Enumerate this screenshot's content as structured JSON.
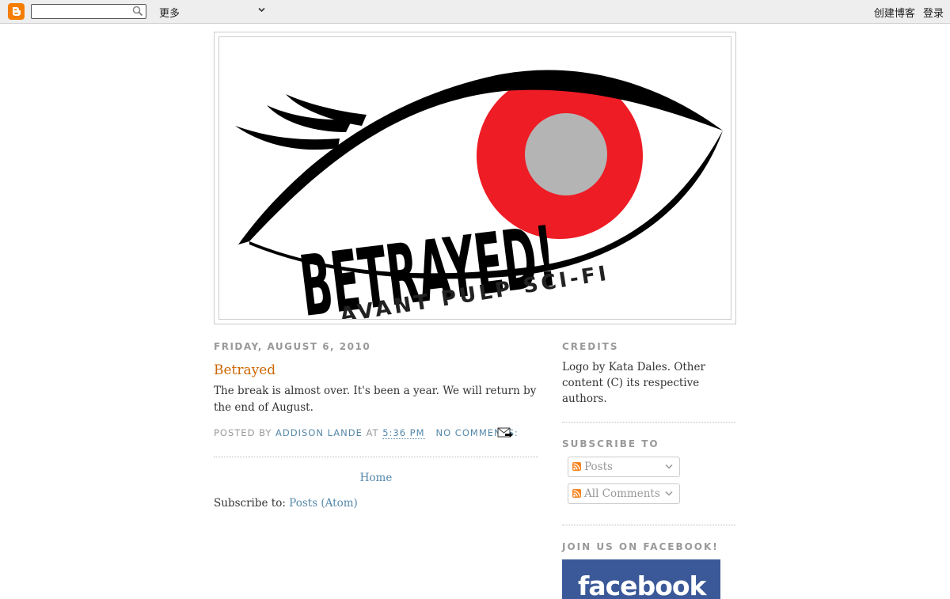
{
  "navbar": {
    "more_label": "更多",
    "create_blog_label": "创建博客",
    "login_label": "登录",
    "search_value": ""
  },
  "header": {
    "logo_title": "BETRAYED!",
    "logo_tagline": "AVANT PULP SCI-FI",
    "colors": {
      "iris": "#ee1c25",
      "pupil": "#b4b4b4",
      "ink": "#000000"
    }
  },
  "post": {
    "date": "Friday, August 6, 2010",
    "title": "Betrayed",
    "body": "The break is almost over. It's been a year. We will return by the end of August.",
    "posted_by_label": "Posted by",
    "author": "Addison Lande",
    "at_label": "at",
    "time": "5:36 PM",
    "comments": "No comments:"
  },
  "footer": {
    "home": "Home",
    "subscribe_label": "Subscribe to:",
    "subscribe_link": "Posts (Atom)"
  },
  "sidebar": {
    "credits_title": "Credits",
    "credits_text": "Logo by Kata Dales. Other content (C) its respective authors.",
    "subscribe_title": "Subscribe To",
    "feeds": [
      "Posts",
      "All Comments"
    ],
    "facebook_title": "Join us on Facebook!",
    "facebook_badge": "facebook"
  },
  "colors": {
    "title": "#cc6600",
    "link": "#5588aa",
    "muted": "#999999",
    "blogger": "#f57d00",
    "facebook": "#3b5998"
  }
}
